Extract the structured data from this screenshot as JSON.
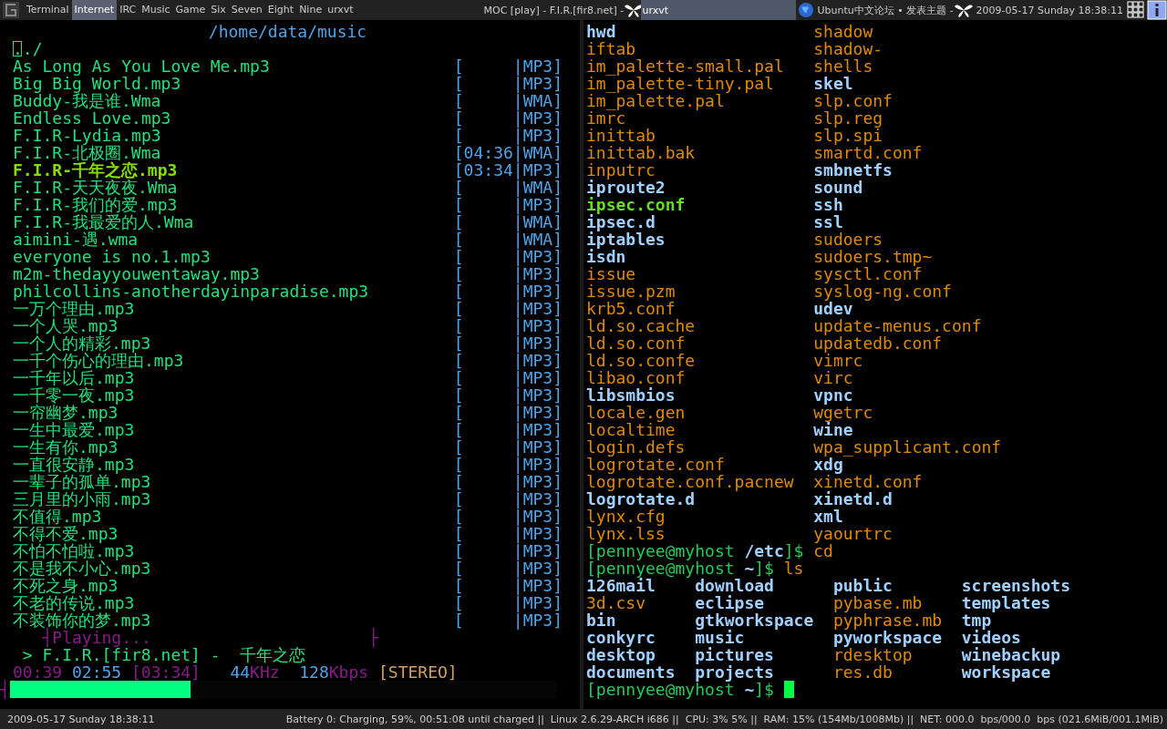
{
  "top_bar": {
    "workspaces": [
      {
        "label": "Terminal",
        "selected": false
      },
      {
        "label": "Internet",
        "selected": true
      },
      {
        "label": "IRC",
        "selected": false
      },
      {
        "label": "Music",
        "selected": false
      },
      {
        "label": "Game",
        "selected": false
      },
      {
        "label": "Six",
        "selected": false
      },
      {
        "label": "Seven",
        "selected": false
      },
      {
        "label": "Eight",
        "selected": false
      },
      {
        "label": "Nine",
        "selected": false
      },
      {
        "label": "urxvt",
        "selected": false
      }
    ],
    "tasks": [
      {
        "title": "MOC [play] - F.I.R.[fir8.net] -",
        "selected": false
      },
      {
        "title": "urxvt",
        "selected": true
      },
      {
        "title": "Ubuntu中文论坛 • 发表主题 -",
        "selected": false
      }
    ],
    "clock": "2009-05-17 Sunday 18:38:11"
  },
  "music_player": {
    "title": "/home/data/music",
    "parent_entry": "../",
    "songs": [
      {
        "name": "As Long As You Love Me.mp3",
        "info": "[     |MP3]",
        "playing": false
      },
      {
        "name": "Big Big World.mp3",
        "info": "[     |MP3]",
        "playing": false
      },
      {
        "name": "Buddy-我是谁.Wma",
        "info": "[     |WMA]",
        "playing": false
      },
      {
        "name": "Endless Love.mp3",
        "info": "[     |MP3]",
        "playing": false
      },
      {
        "name": "F.I.R-Lydia.mp3",
        "info": "[     |MP3]",
        "playing": false
      },
      {
        "name": "F.I.R-北极圈.Wma",
        "info": "[04:36|WMA]",
        "playing": false
      },
      {
        "name": "F.I.R-千年之恋.mp3",
        "info": "[03:34|MP3]",
        "playing": true
      },
      {
        "name": "F.I.R-天天夜夜.Wma",
        "info": "[     |WMA]",
        "playing": false
      },
      {
        "name": "F.I.R-我们的爱.mp3",
        "info": "[     |MP3]",
        "playing": false
      },
      {
        "name": "F.I.R-我最爱的人.Wma",
        "info": "[     |WMA]",
        "playing": false
      },
      {
        "name": "aimini-遇.wma",
        "info": "[     |WMA]",
        "playing": false
      },
      {
        "name": "everyone is no.1.mp3",
        "info": "[     |MP3]",
        "playing": false
      },
      {
        "name": "m2m-thedayyouwentaway.mp3",
        "info": "[     |MP3]",
        "playing": false
      },
      {
        "name": "philcollins-anotherdayinparadise.mp3",
        "info": "[     |MP3]",
        "playing": false
      },
      {
        "name": "一万个理由.mp3",
        "info": "[     |MP3]",
        "playing": false
      },
      {
        "name": "一个人哭.mp3",
        "info": "[     |MP3]",
        "playing": false
      },
      {
        "name": "一个人的精彩.mp3",
        "info": "[     |MP3]",
        "playing": false
      },
      {
        "name": "一千个伤心的理由.mp3",
        "info": "[     |MP3]",
        "playing": false
      },
      {
        "name": "一千年以后.mp3",
        "info": "[     |MP3]",
        "playing": false
      },
      {
        "name": "一千零一夜.mp3",
        "info": "[     |MP3]",
        "playing": false
      },
      {
        "name": "一帘幽梦.mp3",
        "info": "[     |MP3]",
        "playing": false
      },
      {
        "name": "一生中最爱.mp3",
        "info": "[     |MP3]",
        "playing": false
      },
      {
        "name": "一生有你.mp3",
        "info": "[     |MP3]",
        "playing": false
      },
      {
        "name": "一直很安静.mp3",
        "info": "[     |MP3]",
        "playing": false
      },
      {
        "name": "一辈子的孤单.mp3",
        "info": "[     |MP3]",
        "playing": false
      },
      {
        "name": "三月里的小雨.mp3",
        "info": "[     |MP3]",
        "playing": false
      },
      {
        "name": "不值得.mp3",
        "info": "[     |MP3]",
        "playing": false
      },
      {
        "name": "不得不爱.mp3",
        "info": "[     |MP3]",
        "playing": false
      },
      {
        "name": "不怕不怕啦.mp3",
        "info": "[     |MP3]",
        "playing": false
      },
      {
        "name": "不是我不小心.mp3",
        "info": "[     |MP3]",
        "playing": false
      },
      {
        "name": "不死之身.mp3",
        "info": "[     |MP3]",
        "playing": false
      },
      {
        "name": "不老的传说.mp3",
        "info": "[     |MP3]",
        "playing": false
      },
      {
        "name": "不装饰你的梦.mp3",
        "info": "[     |MP3]",
        "playing": false
      }
    ],
    "status_frame_left": "┤",
    "status": "Playing...",
    "status_frame_right": "├",
    "now_playing": "> F.I.R.[fir8.net] -  千年之恋",
    "elapsed": "00:39",
    "remaining": "02:55",
    "total": "[03:34]",
    "rate": "44",
    "rate_unit": "KHz",
    "bitrate": "128",
    "bitrate_unit": "Kbps",
    "channels": "[STEREO]",
    "progress": {
      "frame": "┤",
      "level": 0.33
    }
  },
  "terminal": {
    "etc_rows": [
      [
        {
          "name": "hwd",
          "kind": "dir"
        },
        {
          "name": "shadow",
          "kind": "file"
        }
      ],
      [
        {
          "name": "iftab",
          "kind": "file"
        },
        {
          "name": "shadow-",
          "kind": "file"
        }
      ],
      [
        {
          "name": "im_palette-small.pal",
          "kind": "file"
        },
        {
          "name": "shells",
          "kind": "file"
        }
      ],
      [
        {
          "name": "im_palette-tiny.pal",
          "kind": "file"
        },
        {
          "name": "skel",
          "kind": "dir"
        }
      ],
      [
        {
          "name": "im_palette.pal",
          "kind": "file"
        },
        {
          "name": "slp.conf",
          "kind": "file"
        }
      ],
      [
        {
          "name": "imrc",
          "kind": "file"
        },
        {
          "name": "slp.reg",
          "kind": "file"
        }
      ],
      [
        {
          "name": "inittab",
          "kind": "file"
        },
        {
          "name": "slp.spi",
          "kind": "file"
        }
      ],
      [
        {
          "name": "inittab.bak",
          "kind": "file"
        },
        {
          "name": "smartd.conf",
          "kind": "file"
        }
      ],
      [
        {
          "name": "inputrc",
          "kind": "file"
        },
        {
          "name": "smbnetfs",
          "kind": "dir"
        }
      ],
      [
        {
          "name": "iproute2",
          "kind": "dir"
        },
        {
          "name": "sound",
          "kind": "dir"
        }
      ],
      [
        {
          "name": "ipsec.conf",
          "kind": "exec"
        },
        {
          "name": "ssh",
          "kind": "dir"
        }
      ],
      [
        {
          "name": "ipsec.d",
          "kind": "dir"
        },
        {
          "name": "ssl",
          "kind": "dir"
        }
      ],
      [
        {
          "name": "iptables",
          "kind": "dir"
        },
        {
          "name": "sudoers",
          "kind": "file"
        }
      ],
      [
        {
          "name": "isdn",
          "kind": "dir"
        },
        {
          "name": "sudoers.tmp~",
          "kind": "file"
        }
      ],
      [
        {
          "name": "issue",
          "kind": "file"
        },
        {
          "name": "sysctl.conf",
          "kind": "file"
        }
      ],
      [
        {
          "name": "issue.pzm",
          "kind": "file"
        },
        {
          "name": "syslog-ng.conf",
          "kind": "file"
        }
      ],
      [
        {
          "name": "krb5.conf",
          "kind": "file"
        },
        {
          "name": "udev",
          "kind": "dir"
        }
      ],
      [
        {
          "name": "ld.so.cache",
          "kind": "file"
        },
        {
          "name": "update-menus.conf",
          "kind": "file"
        }
      ],
      [
        {
          "name": "ld.so.conf",
          "kind": "file"
        },
        {
          "name": "updatedb.conf",
          "kind": "file"
        }
      ],
      [
        {
          "name": "ld.so.confe",
          "kind": "file"
        },
        {
          "name": "vimrc",
          "kind": "file"
        }
      ],
      [
        {
          "name": "libao.conf",
          "kind": "file"
        },
        {
          "name": "virc",
          "kind": "file"
        }
      ],
      [
        {
          "name": "libsmbios",
          "kind": "dir"
        },
        {
          "name": "vpnc",
          "kind": "dir"
        }
      ],
      [
        {
          "name": "locale.gen",
          "kind": "file"
        },
        {
          "name": "wgetrc",
          "kind": "file"
        }
      ],
      [
        {
          "name": "localtime",
          "kind": "file"
        },
        {
          "name": "wine",
          "kind": "dir"
        }
      ],
      [
        {
          "name": "login.defs",
          "kind": "file"
        },
        {
          "name": "wpa_supplicant.conf",
          "kind": "file"
        }
      ],
      [
        {
          "name": "logrotate.conf",
          "kind": "file"
        },
        {
          "name": "xdg",
          "kind": "dir"
        }
      ],
      [
        {
          "name": "logrotate.conf.pacnew",
          "kind": "file"
        },
        {
          "name": "xinetd.conf",
          "kind": "file"
        }
      ],
      [
        {
          "name": "logrotate.d",
          "kind": "dir"
        },
        {
          "name": "xinetd.d",
          "kind": "dir"
        }
      ],
      [
        {
          "name": "lynx.cfg",
          "kind": "file"
        },
        {
          "name": "xml",
          "kind": "dir"
        }
      ],
      [
        {
          "name": "lynx.lss",
          "kind": "file"
        },
        {
          "name": "yaourtrc",
          "kind": "file"
        }
      ]
    ],
    "commands": [
      {
        "user_host": "[pennyee@myhost",
        "cwd": "/etc",
        "suffix": "]$",
        "command": "cd"
      },
      {
        "user_host": "[pennyee@myhost",
        "cwd": "~",
        "suffix": "]$",
        "command": "ls"
      }
    ],
    "home_rows": [
      [
        {
          "name": "126mail",
          "kind": "dir"
        },
        {
          "name": "download",
          "kind": "dir"
        },
        {
          "name": "public",
          "kind": "dir"
        },
        {
          "name": "screenshots",
          "kind": "dir"
        }
      ],
      [
        {
          "name": "3d.csv",
          "kind": "file"
        },
        {
          "name": "eclipse",
          "kind": "dir"
        },
        {
          "name": "pybase.mb",
          "kind": "file"
        },
        {
          "name": "templates",
          "kind": "dir"
        }
      ],
      [
        {
          "name": "bin",
          "kind": "dir"
        },
        {
          "name": "gtkworkspace",
          "kind": "dir"
        },
        {
          "name": "pyphrase.mb",
          "kind": "file"
        },
        {
          "name": "tmp",
          "kind": "dir"
        }
      ],
      [
        {
          "name": "conkyrc",
          "kind": "dir"
        },
        {
          "name": "music",
          "kind": "dir"
        },
        {
          "name": "pyworkspace",
          "kind": "dir"
        },
        {
          "name": "videos",
          "kind": "dir"
        }
      ],
      [
        {
          "name": "desktop",
          "kind": "dir"
        },
        {
          "name": "pictures",
          "kind": "dir"
        },
        {
          "name": "rdesktop",
          "kind": "file"
        },
        {
          "name": "winebackup",
          "kind": "dir"
        }
      ],
      [
        {
          "name": "documents",
          "kind": "dir"
        },
        {
          "name": "projects",
          "kind": "dir"
        },
        {
          "name": "res.db",
          "kind": "file"
        },
        {
          "name": "workspace",
          "kind": "dir"
        }
      ]
    ],
    "prompt": {
      "user_host": "[pennyee@myhost",
      "cwd": "~",
      "suffix": "]$",
      "cursor": true
    }
  },
  "status_bar": {
    "clock": "2009-05-17 Sunday 18:38:11",
    "info": "Battery 0: Charging, 59%, 00:51:08 until charged ||  Linux 2.6.29-ARCH i686 ||  CPU: 3% 5% ||  RAM: 15% (154Mb/1008Mb) ||  NET: 000.0  bps/000.0  bps (021.6MiB/001.1MiB)"
  }
}
